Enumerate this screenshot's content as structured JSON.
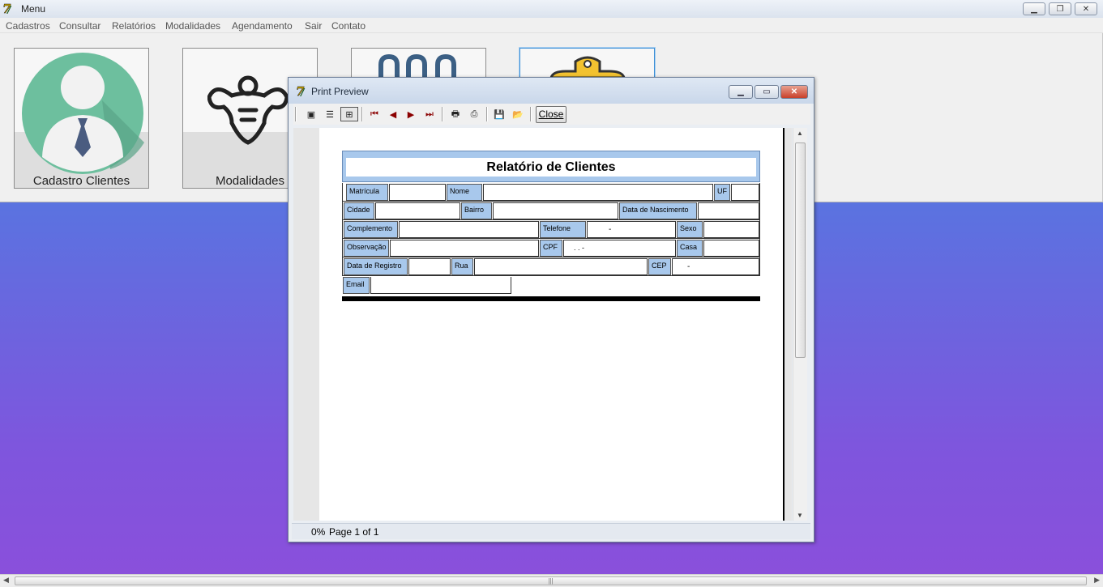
{
  "main": {
    "title": "Menu",
    "menu": [
      "Cadastros",
      "Consultar",
      "Relatórios",
      "Modalidades",
      "Agendamento",
      "Sair",
      "Contato"
    ],
    "tiles": [
      {
        "label": "Cadastro Clientes",
        "icon": "client-avatar-icon"
      },
      {
        "label": "Modalidades",
        "icon": "bodybuilder-icon"
      },
      {
        "label": "",
        "icon": "calendar-icon"
      },
      {
        "label": "",
        "icon": "clipboard-icon"
      }
    ]
  },
  "preview": {
    "title": "Print Preview",
    "close_label": "Close",
    "zoom": "0%",
    "page_info": "Page 1 of 1",
    "toolbar": [
      "whole-page-icon",
      "page-width-icon",
      "100-percent-icon",
      "first-page-icon",
      "prev-page-icon",
      "next-page-icon",
      "last-page-icon",
      "print-setup-icon",
      "print-icon",
      "save-icon",
      "open-icon"
    ]
  },
  "report": {
    "title": "Relatório de Clientes",
    "labels": {
      "matricula": "Matrícula",
      "nome": "Nome",
      "uf": "UF",
      "cidade": "Cidade",
      "bairro": "Bairro",
      "nascimento": "Data de Nascimento",
      "complemento": "Complemento",
      "telefone": "Telefone",
      "sexo": "Sexo",
      "observacao": "Observação",
      "cpf": "CPF",
      "casa": "Casa",
      "registro": "Data de Registro",
      "rua": "Rua",
      "cep": "CEP",
      "email": "Email"
    },
    "values": {
      "telefone": "-",
      "cpf": ". .   -",
      "cep": "-"
    }
  },
  "colors": {
    "label_bg": "#a8c8ec",
    "bg_top": "#5a73e0",
    "bg_bottom": "#8b4fdb",
    "accent": "#3d8fd6"
  }
}
